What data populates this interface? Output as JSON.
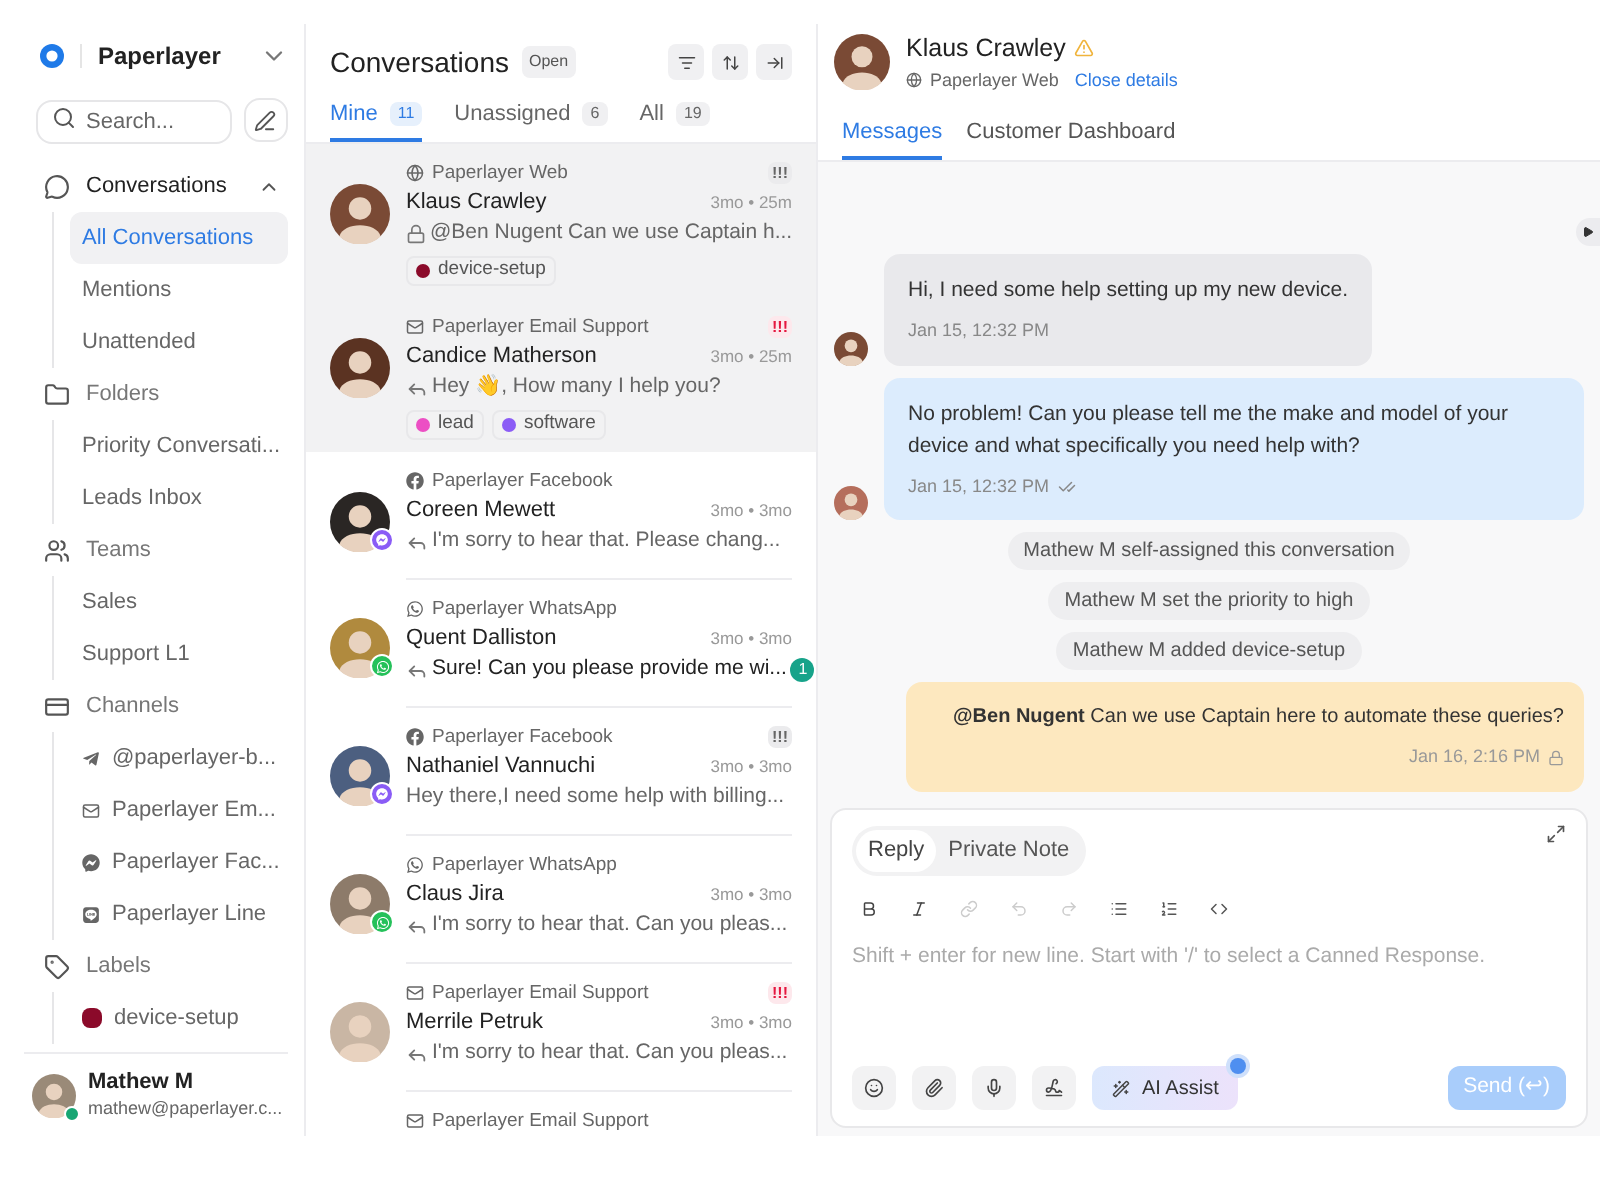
{
  "workspace": {
    "name": "Paperlayer"
  },
  "search": {
    "placeholder": "Search..."
  },
  "sidebar": {
    "sections": [
      {
        "kind": "conversations",
        "label": "Conversations",
        "expanded": true,
        "children": [
          {
            "label": "All Conversations",
            "selected": true
          },
          {
            "label": "Mentions",
            "selected": false
          },
          {
            "label": "Unattended",
            "selected": false
          }
        ]
      },
      {
        "kind": "folders",
        "label": "Folders",
        "expanded": true,
        "children": [
          {
            "label": "Priority Conversati...",
            "selected": false
          },
          {
            "label": "Leads Inbox",
            "selected": false
          }
        ]
      },
      {
        "kind": "teams",
        "label": "Teams",
        "expanded": true,
        "children": [
          {
            "label": "Sales",
            "selected": false
          },
          {
            "label": "Support L1",
            "selected": false
          }
        ]
      },
      {
        "kind": "channels",
        "label": "Channels",
        "expanded": true,
        "children": [
          {
            "label": "@paperlayer-b...",
            "kind": "telegram",
            "selected": false
          },
          {
            "label": "Paperlayer Em...",
            "kind": "email",
            "selected": false
          },
          {
            "label": "Paperlayer Fac...",
            "kind": "messenger",
            "selected": false
          },
          {
            "label": "Paperlayer Line",
            "kind": "line",
            "selected": false
          }
        ]
      },
      {
        "kind": "labels",
        "label": "Labels",
        "expanded": true,
        "children": [
          {
            "label": "device-setup",
            "color": "#8b0a2a",
            "selected": false
          }
        ]
      }
    ]
  },
  "user": {
    "name": "Mathew M",
    "email": "mathew@paperlayer.c...",
    "online": true
  },
  "list": {
    "title": "Conversations",
    "status": "Open",
    "tabs": [
      {
        "label": "Mine",
        "count": "11",
        "selected": true
      },
      {
        "label": "Unassigned",
        "count": "6",
        "selected": false
      },
      {
        "label": "All",
        "count": "19",
        "selected": false
      }
    ],
    "items": [
      {
        "channel": {
          "kind": "web",
          "name": "Paperlayer Web"
        },
        "priority": {
          "kind": "high",
          "text": "!!!"
        },
        "name": "Klaus Crawley",
        "time": "3mo • 25m",
        "preview": {
          "kind": "private",
          "text": "@Ben Nugent Can we use Captain h..."
        },
        "labels": [
          {
            "name": "device-setup",
            "color": "#8b0a2a"
          }
        ],
        "selected": true
      },
      {
        "channel": {
          "kind": "email",
          "name": "Paperlayer Email Support"
        },
        "priority": {
          "kind": "urgent",
          "text": "!!!"
        },
        "name": "Candice Matherson",
        "time": "3mo • 25m",
        "preview": {
          "kind": "reply",
          "text": "Hey 👋, How many I help you?"
        },
        "labels": [
          {
            "name": "lead",
            "color": "#ec4fc4"
          },
          {
            "name": "software",
            "color": "#8b5cf6"
          }
        ],
        "selected": true
      },
      {
        "channel": {
          "kind": "facebook",
          "name": "Paperlayer Facebook"
        },
        "name": "Coreen Mewett",
        "time": "3mo • 3mo",
        "preview": {
          "kind": "reply",
          "text": "I'm sorry to hear that. Please chang..."
        },
        "selected": false
      },
      {
        "channel": {
          "kind": "whatsapp",
          "name": "Paperlayer WhatsApp"
        },
        "name": "Quent Dalliston",
        "time": "3mo • 3mo",
        "preview": {
          "kind": "reply",
          "text": "Sure! Can you please provide me wi..."
        },
        "unread": "1",
        "selected": false
      },
      {
        "channel": {
          "kind": "facebook",
          "name": "Paperlayer Facebook"
        },
        "priority": {
          "kind": "high",
          "text": "!!!"
        },
        "name": "Nathaniel Vannuchi",
        "time": "3mo • 3mo",
        "preview": {
          "kind": "plain",
          "text": "Hey there,I need some help with billing..."
        },
        "selected": false
      },
      {
        "channel": {
          "kind": "whatsapp",
          "name": "Paperlayer WhatsApp"
        },
        "name": "Claus Jira",
        "time": "3mo • 3mo",
        "preview": {
          "kind": "reply",
          "text": "I'm sorry to hear that. Can you pleas..."
        },
        "selected": false
      },
      {
        "channel": {
          "kind": "email",
          "name": "Paperlayer Email Support"
        },
        "priority": {
          "kind": "urgent",
          "text": "!!!"
        },
        "name": "Merrile Petruk",
        "time": "3mo • 3mo",
        "preview": {
          "kind": "reply",
          "text": "I'm sorry to hear that. Can you pleas..."
        },
        "selected": false
      },
      {
        "channel": {
          "kind": "email",
          "name": "Paperlayer Email Support"
        },
        "selected": false
      }
    ]
  },
  "detail": {
    "name": "Klaus Crawley",
    "warning": true,
    "channel": "Paperlayer Web",
    "close_link": "Close details",
    "tabs": [
      {
        "label": "Messages",
        "selected": true
      },
      {
        "label": "Customer Dashboard",
        "selected": false
      }
    ],
    "messages": [
      {
        "kind": "incoming",
        "text": "Hi, I need some help setting up my new device.",
        "time": "Jan 15, 12:32 PM"
      },
      {
        "kind": "outgoing",
        "text": "No problem! Can you please tell me the make and model of your device and what specifically you need help with?",
        "time": "Jan 15, 12:32 PM"
      },
      {
        "kind": "activity",
        "text": "Mathew M self-assigned this conversation"
      },
      {
        "kind": "activity",
        "text": "Mathew M set the priority to high"
      },
      {
        "kind": "activity",
        "text": "Mathew M added device-setup"
      },
      {
        "kind": "private",
        "text": "**@Ben Nugent** Can we use Captain here to automate these queries?",
        "time": "Jan 16, 2:16 PM"
      }
    ],
    "composer": {
      "tabs": [
        {
          "label": "Reply",
          "selected": true
        },
        {
          "label": "Private Note",
          "selected": false
        }
      ],
      "placeholder": "Shift + enter for new line. Start with '/' to select a Canned Response.",
      "ai_button": "AI Assist",
      "send": {
        "label": "Send (↩)",
        "disabled": true
      }
    }
  }
}
